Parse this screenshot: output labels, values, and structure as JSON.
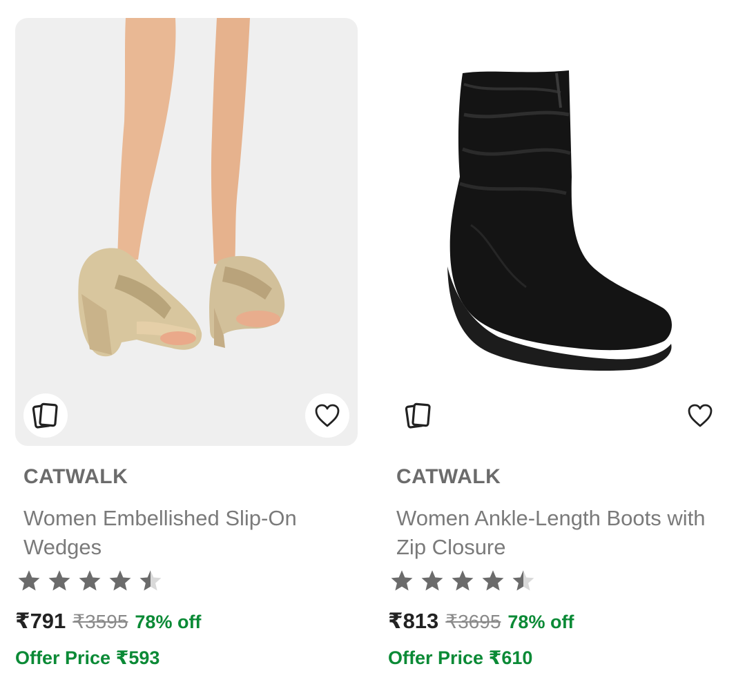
{
  "products": [
    {
      "brand": "CATWALK",
      "title": "Women Embellished Slip-On Wedges",
      "rating": 4.5,
      "rating_max": 5,
      "price": "₹791",
      "mrp": "₹3595",
      "discount": "78% off",
      "offer_label": "Offer Price ",
      "offer_price": "₹593",
      "similar_icon": "similar-products-icon",
      "wishlist_icon": "heart-icon"
    },
    {
      "brand": "CATWALK",
      "title": "Women Ankle-Length Boots with Zip Closure",
      "rating": 4.5,
      "rating_max": 5,
      "price": "₹813",
      "mrp": "₹3695",
      "discount": "78% off",
      "offer_label": "Offer Price ",
      "offer_price": "₹610",
      "similar_icon": "similar-products-icon",
      "wishlist_icon": "heart-icon"
    }
  ],
  "colors": {
    "brand_text": "#6b6b6b",
    "discount_green": "#0b8a36",
    "star_filled": "#6b6b6b",
    "star_empty": "#d9d9d9"
  }
}
